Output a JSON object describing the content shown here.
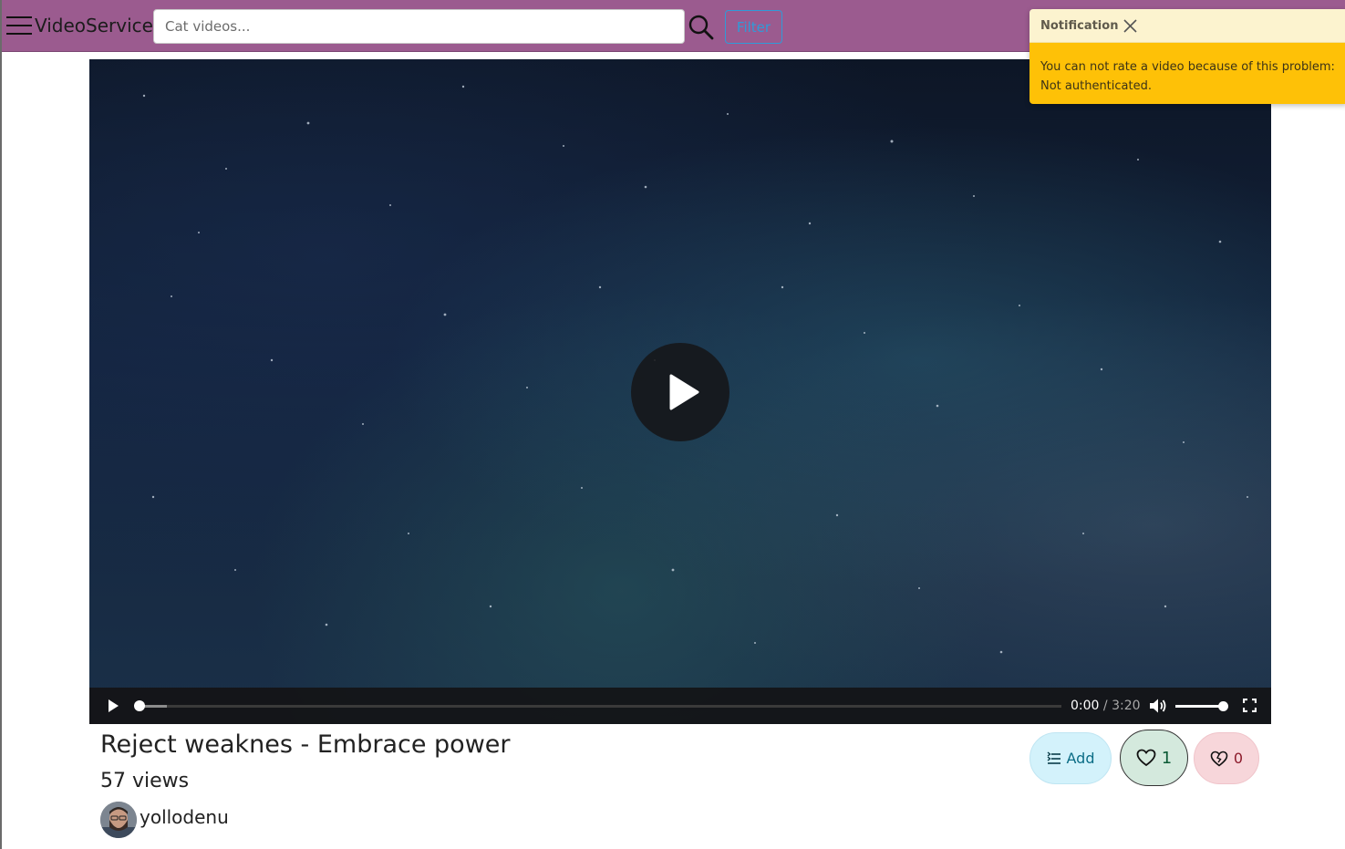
{
  "header": {
    "brand": "VideoService",
    "search_placeholder": "Cat videos...",
    "filter_label": "Filter",
    "background": "#9b5b8f"
  },
  "notification": {
    "title": "Notification",
    "message_line1": "You can not rate a video because of this problem:",
    "message_line2": "Not authenticated."
  },
  "player": {
    "current_time": "0:00",
    "separator": " / ",
    "duration": "3:20",
    "progress": 0.0,
    "volume": 1.0
  },
  "video": {
    "title": "Reject weaknes - Embrace power",
    "views": "57 views",
    "channel": "yollodenu"
  },
  "actions": {
    "add_label": "Add",
    "like_count": "1",
    "dislike_count": "0"
  }
}
